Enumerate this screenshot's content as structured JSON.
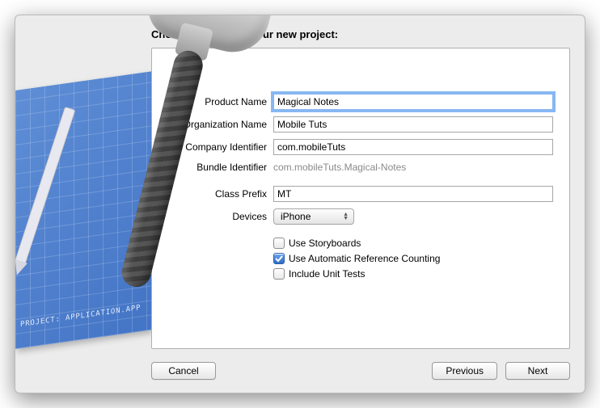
{
  "header": {
    "title": "Choose options for your new project:"
  },
  "form": {
    "product_name": {
      "label": "Product Name",
      "value": "Magical Notes"
    },
    "organization_name": {
      "label": "Organization Name",
      "value": "Mobile Tuts"
    },
    "company_identifier": {
      "label": "Company Identifier",
      "value": "com.mobileTuts"
    },
    "bundle_identifier": {
      "label": "Bundle Identifier",
      "value": "com.mobileTuts.Magical-Notes"
    },
    "class_prefix": {
      "label": "Class Prefix",
      "value": "MT"
    },
    "devices": {
      "label": "Devices",
      "selected": "iPhone"
    },
    "use_storyboards": {
      "label": "Use Storyboards",
      "checked": false
    },
    "use_arc": {
      "label": "Use Automatic Reference Counting",
      "checked": true
    },
    "include_unit_tests": {
      "label": "Include Unit Tests",
      "checked": false
    }
  },
  "buttons": {
    "cancel": "Cancel",
    "previous": "Previous",
    "next": "Next"
  },
  "art": {
    "blueprint_label": "PROJECT: APPLICATION.APP"
  }
}
